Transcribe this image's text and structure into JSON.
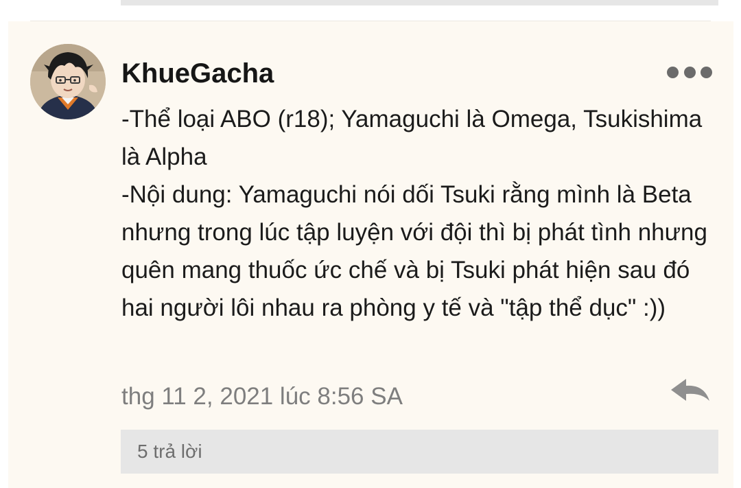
{
  "comment": {
    "username": "KhueGacha",
    "avatar_alt": "avatar",
    "body_lines": [
      "-Thể loại ABO (r18); Yamaguchi là Omega, Tsukishima là Alpha",
      "-Nội dung: Yamaguchi nói dối Tsuki rằng mình là Beta nhưng trong lúc tập luyện với đội thì bị phát tình nhưng quên mang thuốc ức chế và bị Tsuki phát hiện sau đó hai người lôi nhau ra phòng y tế và \"tập thể dục\" :))"
    ],
    "timestamp": "thg 11 2, 2021 lúc 8:56 SA",
    "replies_label": "5 trả lời",
    "icons": {
      "more": "more-options-icon",
      "reply": "reply-arrow-icon"
    }
  },
  "colors": {
    "card_background": "#fdf9f2",
    "reply_bar": "#e6e6e6",
    "meta_text": "#7e7e7e",
    "icon_gray": "#6b6b6b"
  }
}
